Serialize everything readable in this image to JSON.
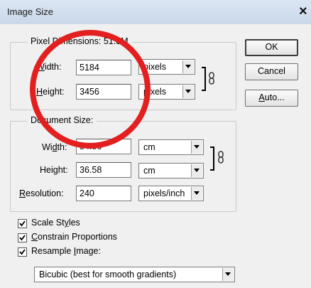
{
  "window": {
    "title": "Image Size",
    "close_label": "×"
  },
  "pixel_dimensions": {
    "legend": "Pixel Dimensions: 51.3M",
    "width": {
      "label_pre": "",
      "mnemonic": "W",
      "label_post": "idth:",
      "value": "5184",
      "unit": "pixels"
    },
    "height": {
      "label_pre": "",
      "mnemonic": "H",
      "label_post": "eight:",
      "value": "3456",
      "unit": "pixels"
    },
    "link_icon": "chain-link-icon"
  },
  "document_size": {
    "legend": "Document Size:",
    "width": {
      "label_pre": "Wi",
      "mnemonic": "d",
      "label_post": "th:",
      "value": "54.86",
      "unit": "cm"
    },
    "height": {
      "label_pre": "Hei",
      "mnemonic": "g",
      "label_post": "ht:",
      "value": "36.58",
      "unit": "cm"
    },
    "resolution": {
      "label_pre": "",
      "mnemonic": "R",
      "label_post": "esolution:",
      "value": "240",
      "unit": "pixels/inch"
    },
    "link_icon": "chain-link-icon"
  },
  "buttons": {
    "ok": "OK",
    "cancel": "Cancel",
    "auto_mnemonic": "A",
    "auto_rest": "uto..."
  },
  "options": {
    "scale_styles": {
      "pre": "Scale St",
      "mnemonic": "y",
      "post": "les",
      "checked": true
    },
    "constrain": {
      "pre": "",
      "mnemonic": "C",
      "post": "onstrain Proportions",
      "checked": true
    },
    "resample": {
      "pre": "Resample ",
      "mnemonic": "I",
      "post": "mage:",
      "checked": true
    },
    "method": "Bicubic (best for smooth gradients)"
  },
  "annotation": {
    "shape": "red-circle",
    "color": "#e41f1f"
  }
}
